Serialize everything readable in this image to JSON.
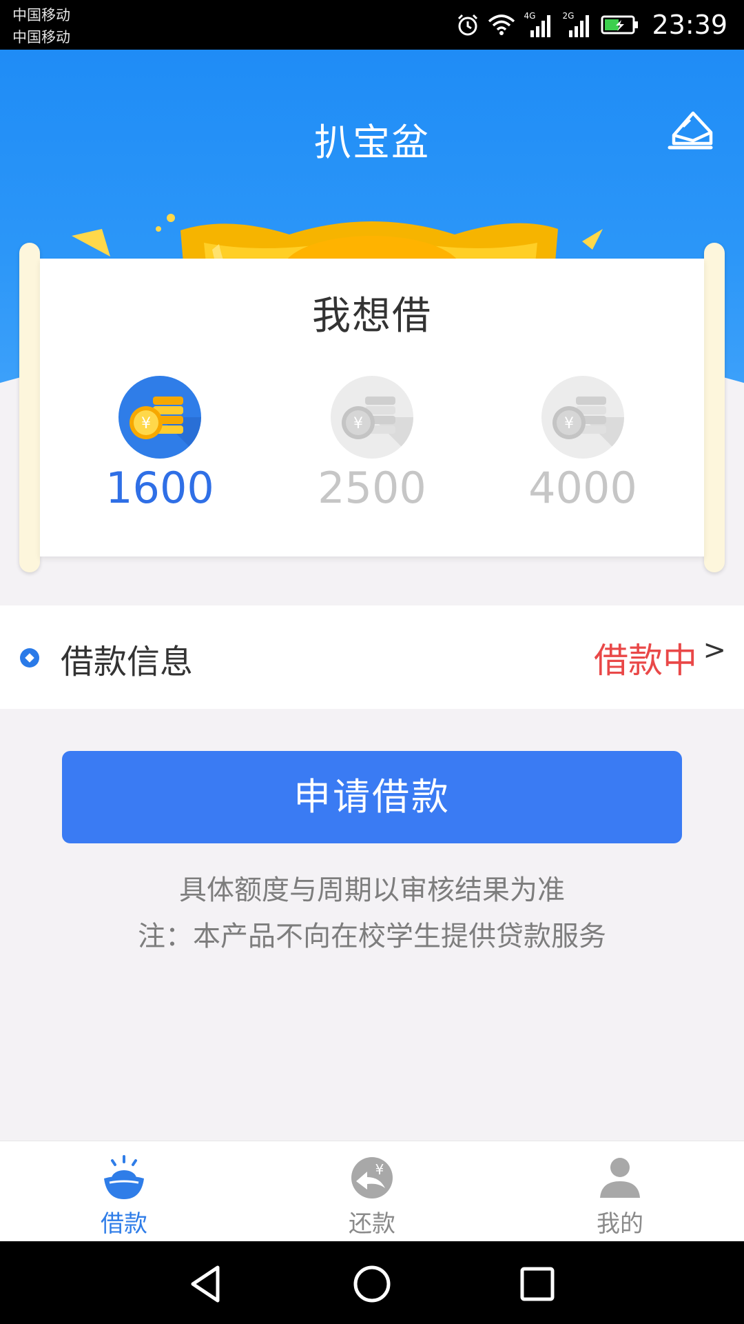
{
  "status_bar": {
    "carrier_1": "中国移动",
    "carrier_2": "中国移动",
    "network_1": "4G",
    "network_2": "2G",
    "time": "23:39"
  },
  "header": {
    "title": "扒宝盆"
  },
  "card": {
    "title": "我想借",
    "amounts": [
      {
        "value": "1600",
        "selected": true
      },
      {
        "value": "2500",
        "selected": false
      },
      {
        "value": "4000",
        "selected": false
      }
    ]
  },
  "info": {
    "label": "借款信息",
    "status": "借款中",
    "arrow": ">"
  },
  "apply": {
    "label": "申请借款"
  },
  "notes": {
    "line1": "具体额度与周期以审核结果为准",
    "line2": "注：本产品不向在校学生提供贷款服务"
  },
  "tabs": [
    {
      "label": "借款",
      "active": true
    },
    {
      "label": "还款",
      "active": false
    },
    {
      "label": "我的",
      "active": false
    }
  ],
  "colors": {
    "primary": "#2f7de8",
    "button": "#3a7bf3",
    "status_red": "#e94848",
    "header_blue": "#1f8cf6"
  }
}
